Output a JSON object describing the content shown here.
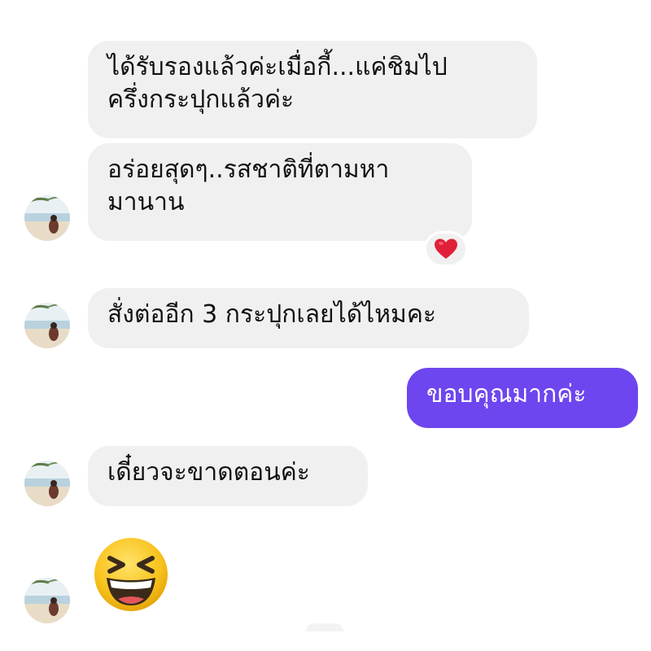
{
  "conversation": {
    "messages": [
      {
        "direction": "incoming",
        "lines": [
          "ได้รับรองแล้วค่ะเมื่อกี้...แค่ชิมไป",
          "ครึ่งกระปุกแล้วค่ะ"
        ]
      },
      {
        "direction": "incoming",
        "lines": [
          "อร่อยสุดๆ..รสชาติที่ตามหา",
          "มานาน"
        ],
        "reaction": "heart"
      },
      {
        "direction": "incoming",
        "lines": [
          "สั่งต่ออีก 3 กระปุกเลยได้ไหมคะ"
        ]
      },
      {
        "direction": "outgoing",
        "lines": [
          "ขอบคุณมากค่ะ"
        ]
      },
      {
        "direction": "incoming",
        "lines": [
          "เดี๋ยวจะขาดตอนค่ะ"
        ]
      },
      {
        "direction": "incoming",
        "emoji": "grinning-squinting-face"
      }
    ]
  },
  "colors": {
    "incoming_bubble": "#f0f0f0",
    "outgoing_bubble": "#6e46ef",
    "heart": "#e0203a"
  }
}
